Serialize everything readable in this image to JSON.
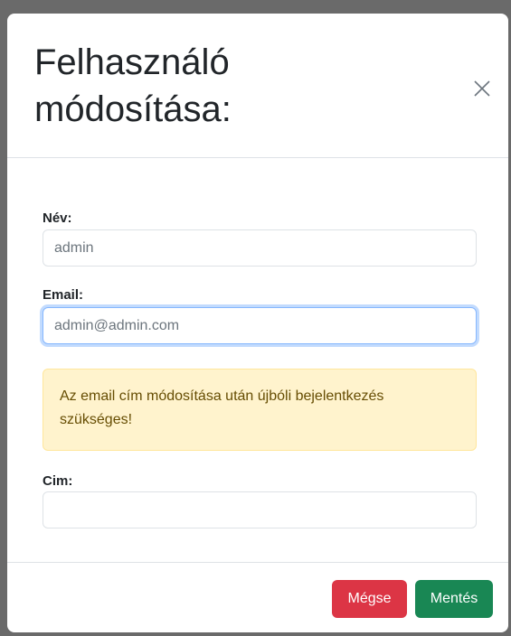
{
  "dialog": {
    "title": "Felhasználó módosítása:"
  },
  "form": {
    "name_label": "Név:",
    "name_value": "admin",
    "email_label": "Email:",
    "email_value": "admin@admin.com",
    "warning": "Az email cím módosítása után újbóli bejelentkezés szükséges!",
    "address_label": "Cim:",
    "address_value": ""
  },
  "footer": {
    "cancel_label": "Mégse",
    "save_label": "Mentés"
  },
  "colors": {
    "cancel": "#dc3545",
    "save": "#198754",
    "warning_bg": "#fff3cd",
    "focus_border": "#86b7fe"
  },
  "icons": {
    "close": "close-icon"
  }
}
